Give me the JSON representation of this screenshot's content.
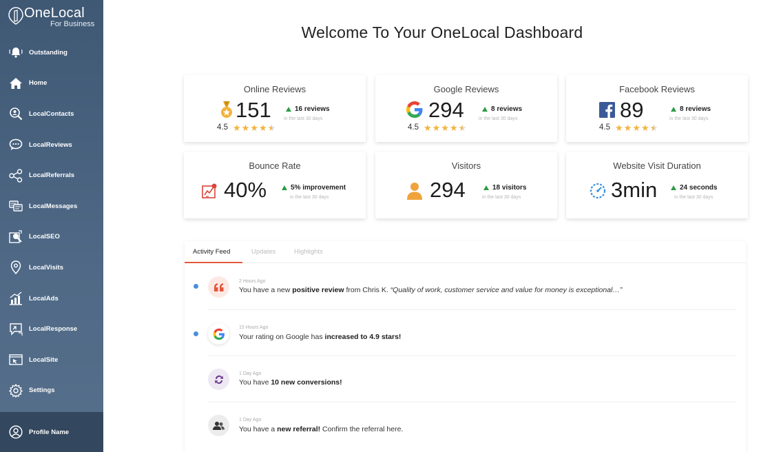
{
  "brand": {
    "name": "OneLocal",
    "subtitle": "For Business"
  },
  "sidebar": {
    "items": [
      {
        "label": "Outstanding",
        "icon": "bell-icon"
      },
      {
        "label": "Home",
        "icon": "home-icon"
      },
      {
        "label": "LocalContacts",
        "icon": "contacts-search-icon"
      },
      {
        "label": "LocalReviews",
        "icon": "chat-bubble-icon"
      },
      {
        "label": "LocalReferrals",
        "icon": "share-icon"
      },
      {
        "label": "LocalMessages",
        "icon": "messages-icon"
      },
      {
        "label": "LocalSEO",
        "icon": "seo-icon"
      },
      {
        "label": "LocalVisits",
        "icon": "location-pin-icon"
      },
      {
        "label": "LocalAds",
        "icon": "ads-chart-icon"
      },
      {
        "label": "LocalResponse",
        "icon": "response-icon"
      },
      {
        "label": "LocalSite",
        "icon": "site-icon"
      },
      {
        "label": "Settings",
        "icon": "gear-icon"
      }
    ],
    "profile": {
      "label": "Profile Name",
      "icon": "user-circle-icon"
    }
  },
  "page": {
    "title": "Welcome To Your OneLocal Dashboard"
  },
  "cards": {
    "online_reviews": {
      "title": "Online Reviews",
      "value": "151",
      "rating": "4.5",
      "rating_value": 4.5,
      "delta": "16 reviews",
      "note": "in the last 30 days",
      "icon": "medal-icon"
    },
    "google_reviews": {
      "title": "Google Reviews",
      "value": "294",
      "rating": "4.5",
      "rating_value": 4.5,
      "delta": "8 reviews",
      "note": "in the last 30 days",
      "icon": "google-icon"
    },
    "facebook_reviews": {
      "title": "Facebook Reviews",
      "value": "89",
      "rating": "4.5",
      "rating_value": 4.5,
      "delta": "8 reviews",
      "note": "in the last 30 days",
      "icon": "facebook-icon"
    },
    "bounce_rate": {
      "title": "Bounce Rate",
      "value": "40%",
      "delta": "5% improvement",
      "note": "in the last 30 days",
      "icon": "bounce-chart-icon"
    },
    "visitors": {
      "title": "Visitors",
      "value": "294",
      "delta": "18 visitors",
      "note": "in the last 30 days",
      "icon": "person-icon"
    },
    "visit_duration": {
      "title": "Website Visit Duration",
      "value": "3min",
      "delta": "24 seconds",
      "note": "in the last 30 days",
      "icon": "speedometer-icon"
    }
  },
  "feed": {
    "tabs": [
      "Activity Feed",
      "Updates",
      "Highlights"
    ],
    "active_tab": "Activity Feed",
    "items": [
      {
        "time": "2 Hours Ago",
        "pre": "You have a new ",
        "bold": "positive review",
        "mid": " from Chris K. ",
        "italic": "“Quality of work, customer service and value for money is exceptional…”",
        "post": "",
        "unread": true,
        "icon": "quote-icon"
      },
      {
        "time": "15 Hours Ago",
        "pre": "Your rating on Google has ",
        "bold": "increased to 4.9 stars!",
        "mid": "",
        "italic": "",
        "post": "",
        "unread": true,
        "icon": "google-icon"
      },
      {
        "time": "1 Day Ago",
        "pre": "You have ",
        "bold": "10 new conversions!",
        "mid": "",
        "italic": "",
        "post": "",
        "unread": false,
        "icon": "refresh-icon"
      },
      {
        "time": "1 Day Ago",
        "pre": "You have a ",
        "bold": "new referral!",
        "mid": " Confirm the referral here.",
        "italic": "",
        "post": "",
        "unread": false,
        "icon": "people-icon"
      }
    ]
  },
  "colors": {
    "sidebar": "#4a6380",
    "accent": "#e2573b",
    "up_arrow": "#2e9b45",
    "star": "#f2b33d",
    "unread_dot": "#4a8fdc"
  }
}
